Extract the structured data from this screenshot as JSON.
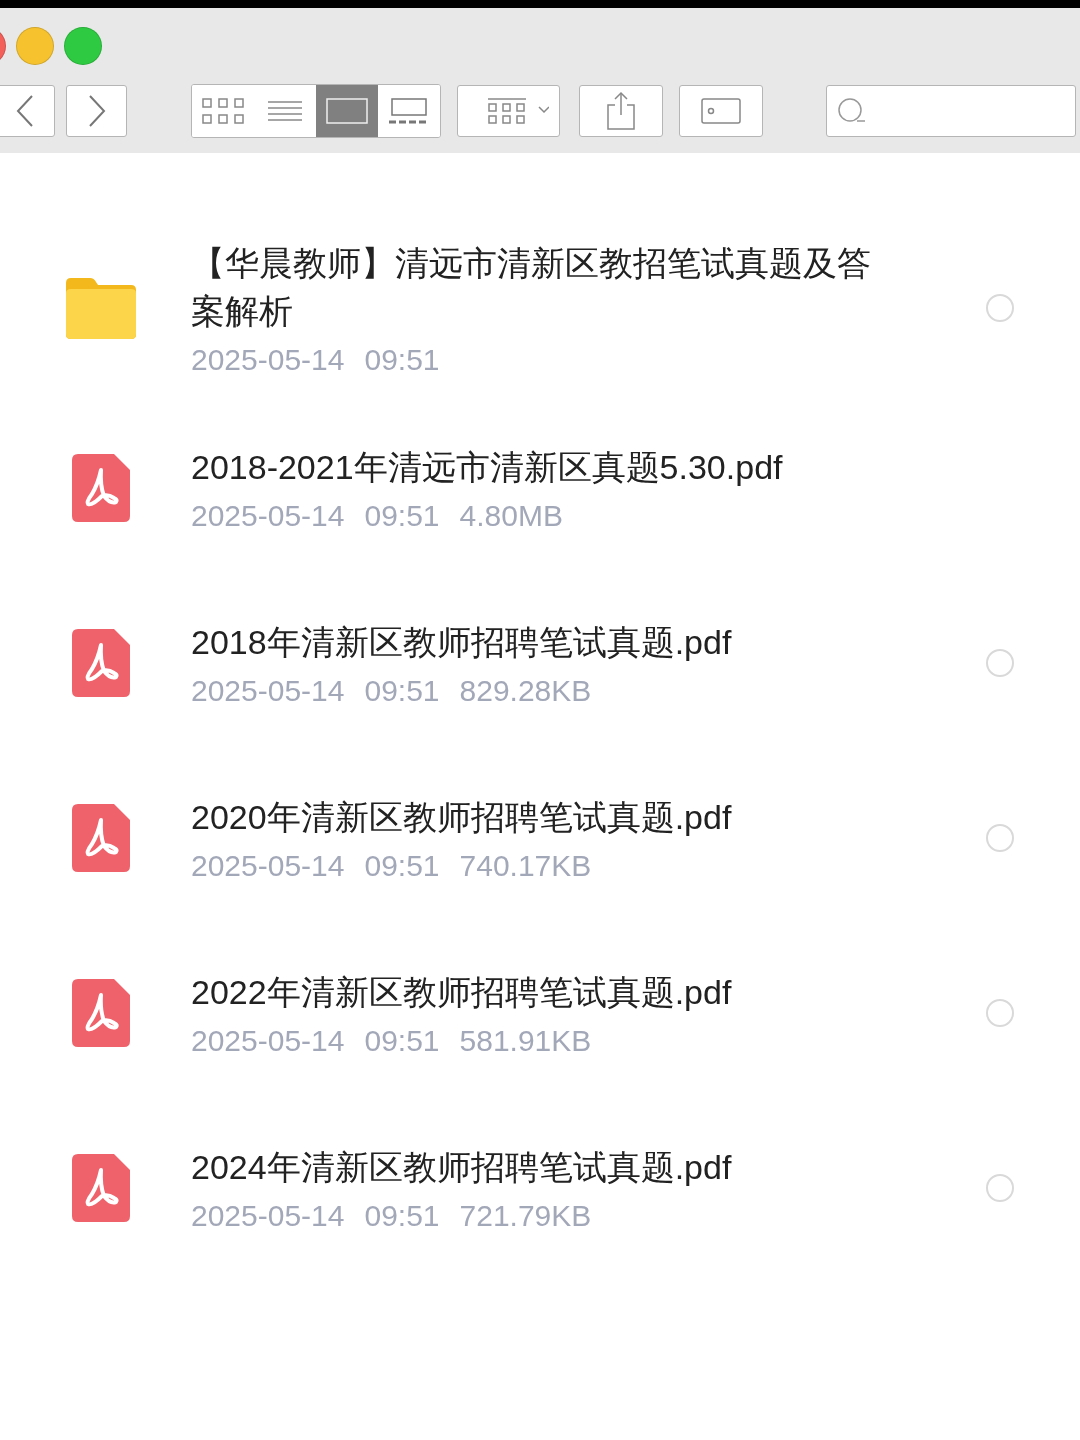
{
  "toolbar": {
    "view_modes": [
      {
        "kind": "grid",
        "selected": false
      },
      {
        "kind": "list",
        "selected": false
      },
      {
        "kind": "columns",
        "selected": true
      },
      {
        "kind": "gallery",
        "selected": false
      }
    ]
  },
  "files": [
    {
      "kind": "folder",
      "name": "【华晨教师】清远市清新区教招笔试真题及答案解析",
      "date": "2025-05-14",
      "time": "09:51",
      "selected": false
    },
    {
      "kind": "pdf",
      "name": "2018-2021年清远市清新区真题5.30.pdf",
      "date": "2025-05-14",
      "time": "09:51",
      "size": "4.80MB"
    },
    {
      "kind": "pdf",
      "name": "2018年清新区教师招聘笔试真题.pdf",
      "date": "2025-05-14",
      "time": "09:51",
      "size": "829.28KB",
      "selected": false
    },
    {
      "kind": "pdf",
      "name": "2020年清新区教师招聘笔试真题.pdf",
      "date": "2025-05-14",
      "time": "09:51",
      "size": "740.17KB",
      "selected": false
    },
    {
      "kind": "pdf",
      "name": "2022年清新区教师招聘笔试真题.pdf",
      "date": "2025-05-14",
      "time": "09:51",
      "size": "581.91KB",
      "selected": false
    },
    {
      "kind": "pdf",
      "name": "2024年清新区教师招聘笔试真题.pdf",
      "date": "2025-05-14",
      "time": "09:51",
      "size": "721.79KB",
      "selected": false
    }
  ]
}
